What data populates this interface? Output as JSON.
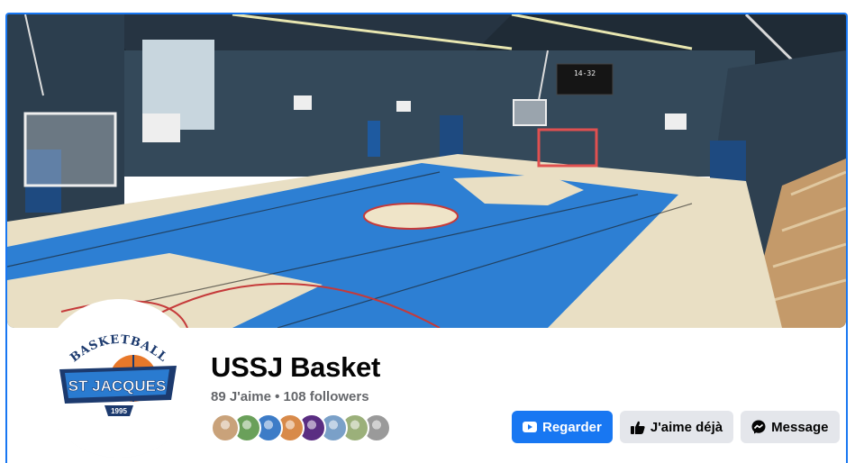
{
  "page": {
    "name": "USSJ Basket",
    "stats": "89 J'aime • 108 followers"
  },
  "logo": {
    "top_text": "BASKETBALL",
    "main_text": "ST JACQUES",
    "year": "1995"
  },
  "cover": {
    "scoreboard": "14-32"
  },
  "friends": {
    "count_shown": 8,
    "colors": [
      "#c9a27a",
      "#6aa05a",
      "#3d7cc7",
      "#d88a4a",
      "#5a2d82",
      "#7aa0c8",
      "#9bb07a",
      "#9a9a9a"
    ]
  },
  "actions": [
    {
      "label": "Regarder",
      "icon": "play-icon",
      "primary": true
    },
    {
      "label": "J'aime déjà",
      "icon": "thumbs-up-icon",
      "primary": false
    },
    {
      "label": "Message",
      "icon": "messenger-icon",
      "primary": false
    }
  ],
  "colors": {
    "accent": "#1877f2",
    "secondary_button": "#e4e6eb",
    "logo_navy": "#1c3a6e",
    "logo_orange": "#e8782a"
  }
}
